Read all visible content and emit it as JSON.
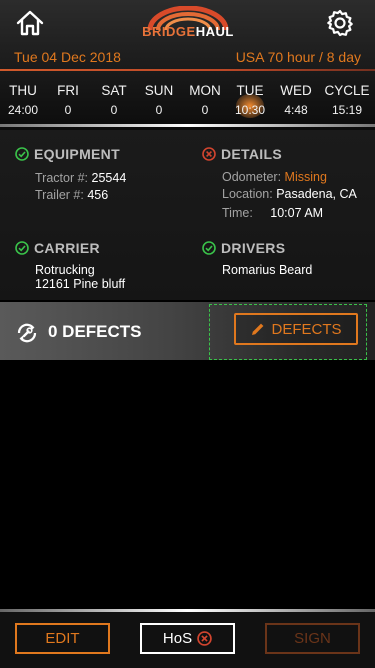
{
  "header": {
    "logo_text_1": "BRIDGE",
    "logo_text_2": "HAUL",
    "date": "Tue 04 Dec 2018",
    "rule": "USA 70 hour / 8 day",
    "home_icon": "home-icon",
    "settings_icon": "gear-icon"
  },
  "days": [
    {
      "name": "THU",
      "value": "24:00"
    },
    {
      "name": "FRI",
      "value": "0"
    },
    {
      "name": "SAT",
      "value": "0"
    },
    {
      "name": "SUN",
      "value": "0"
    },
    {
      "name": "MON",
      "value": "0"
    },
    {
      "name": "TUE",
      "value": "10:30"
    },
    {
      "name": "WED",
      "value": "4:48"
    },
    {
      "name": "CYCLE",
      "value": "15:19"
    }
  ],
  "equipment": {
    "title": "EQUIPMENT",
    "tractor_label": "Tractor #:",
    "tractor_value": "25544",
    "trailer_label": "Trailer #:",
    "trailer_value": "456",
    "status": "ok"
  },
  "details": {
    "title": "DETAILS",
    "odometer_label": "Odometer:",
    "odometer_value": "Missing",
    "location_label": "Location:",
    "location_value": "Pasadena, CA",
    "time_label": "Time:",
    "time_value": "10:07 AM",
    "status": "error"
  },
  "carrier": {
    "title": "CARRIER",
    "name": "Rotrucking",
    "address": "12161 Pine bluff"
  },
  "drivers": {
    "title": "DRIVERS",
    "name": "Romarius Beard"
  },
  "defects": {
    "count_label": "0 DEFECTS",
    "button_label": "DEFECTS"
  },
  "footer": {
    "edit_label": "EDIT",
    "hos_label": "HoS",
    "sign_label": "SIGN"
  },
  "colors": {
    "accent": "#e0781e",
    "ok": "#3ac24a",
    "error": "#d2452f"
  }
}
